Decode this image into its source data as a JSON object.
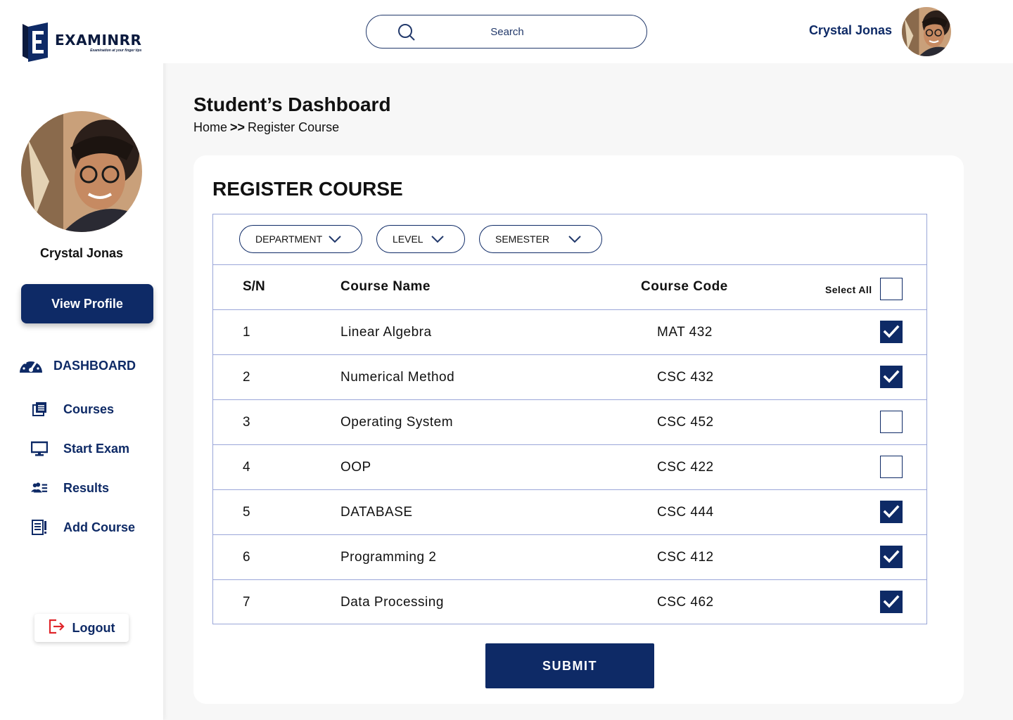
{
  "app": {
    "logo_name": "EXAMINRR",
    "logo_tagline": "Examination at your finger tips"
  },
  "sidebar": {
    "user_name": "Crystal Jonas",
    "view_profile_label": "View Profile",
    "dashboard_label": "DASHBOARD",
    "items": [
      {
        "label": "Courses",
        "icon": "courses-icon"
      },
      {
        "label": "Start Exam",
        "icon": "monitor-icon"
      },
      {
        "label": "Results",
        "icon": "users-list-icon"
      },
      {
        "label": "Add Course",
        "icon": "document-add-icon"
      }
    ],
    "logout_label": "Logout"
  },
  "topbar": {
    "search_placeholder": "Search",
    "user_name": "Crystal Jonas"
  },
  "page": {
    "title": "Student’s Dashboard",
    "breadcrumb_home": "Home",
    "breadcrumb_sep": ">>",
    "breadcrumb_current": "Register Course"
  },
  "register": {
    "title": "REGISTER COURSE",
    "filters": [
      "DEPARTMENT",
      "LEVEL",
      "SEMESTER"
    ],
    "headers": {
      "sn": "S/N",
      "name": "Course Name",
      "code": "Course Code",
      "select_all": "Select All"
    },
    "select_all_checked": false,
    "rows": [
      {
        "sn": "1",
        "name": "Linear Algebra",
        "code": "MAT 432",
        "checked": true
      },
      {
        "sn": "2",
        "name": "Numerical Method",
        "code": "CSC 432",
        "checked": true
      },
      {
        "sn": "3",
        "name": "Operating System",
        "code": "CSC 452",
        "checked": false
      },
      {
        "sn": "4",
        "name": "OOP",
        "code": "CSC 422",
        "checked": false
      },
      {
        "sn": "5",
        "name": "DATABASE",
        "code": "CSC 444",
        "checked": true
      },
      {
        "sn": "6",
        "name": "Programming 2",
        "code": "CSC 412",
        "checked": true
      },
      {
        "sn": "7",
        "name": "Data Processing",
        "code": "CSC 462",
        "checked": true
      }
    ],
    "submit_label": "SUBMIT"
  },
  "colors": {
    "primary": "#0e2a66",
    "border": "#9aa6d8",
    "logout_icon": "#e0262b"
  }
}
